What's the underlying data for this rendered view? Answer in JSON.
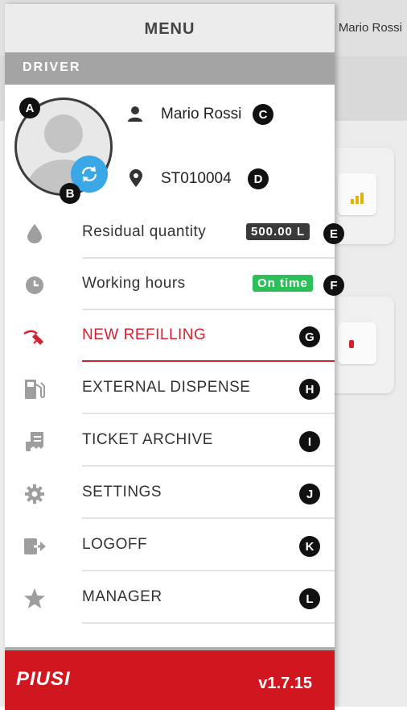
{
  "header": {
    "title": "MENU",
    "background_user": "Mario Rossi"
  },
  "driver_section": {
    "label": "DRIVER"
  },
  "profile": {
    "name": "Mario Rossi",
    "id": "ST010004",
    "badges": {
      "avatar": "A",
      "refresh": "B",
      "name": "C",
      "id": "D"
    }
  },
  "status": {
    "residual": {
      "label": "Residual quantity",
      "value": "500.00 L",
      "badge": "E"
    },
    "hours": {
      "label": "Working hours",
      "value": "On time",
      "badge": "F"
    }
  },
  "menu": {
    "items": [
      {
        "label": "NEW REFILLING",
        "badge": "G",
        "icon": "fuel-nozzle-icon"
      },
      {
        "label": "EXTERNAL DISPENSE",
        "badge": "H",
        "icon": "fuel-pump-icon"
      },
      {
        "label": "TICKET ARCHIVE",
        "badge": "I",
        "icon": "receipt-icon"
      },
      {
        "label": "SETTINGS",
        "badge": "J",
        "icon": "gear-icon"
      },
      {
        "label": "LOGOFF",
        "badge": "K",
        "icon": "logout-icon"
      },
      {
        "label": "MANAGER",
        "badge": "L",
        "icon": "star-icon"
      }
    ]
  },
  "footer": {
    "brand": "PIUSI",
    "version": "v1.7.15"
  },
  "colors": {
    "accent_red": "#d42030",
    "refresh_blue": "#3aa7e6",
    "ok_green": "#2bbf5a",
    "pill_dark": "#3a3a3a"
  }
}
